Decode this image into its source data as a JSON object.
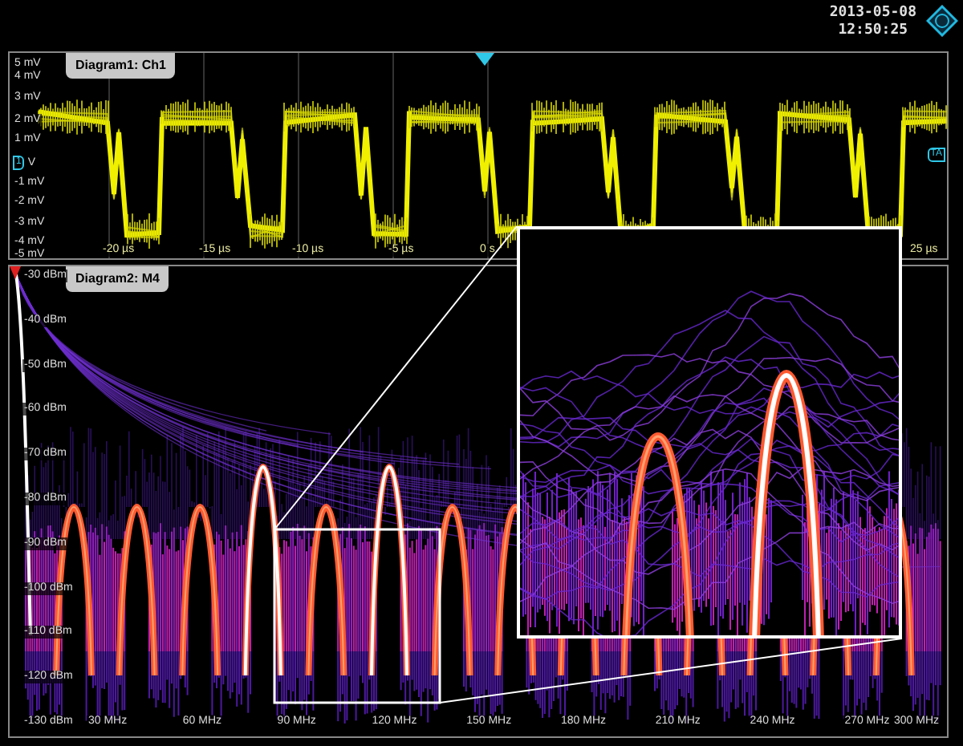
{
  "header": {
    "date": "2013-05-08",
    "time": "12:50:25"
  },
  "diagram1": {
    "title": "Diagram1: Ch1",
    "zero_marker": "1",
    "trigger_marker": "TA",
    "y_axis_labels": [
      "5 mV",
      "4 mV",
      "3 mV",
      "2 mV",
      "1 mV",
      "V",
      "-1 mV",
      "-2 mV",
      "-3 mV",
      "-4 mV",
      "-5 mV"
    ],
    "x_axis_labels": [
      "-20 µs",
      "-15 µs",
      "-10 µs",
      "-5 µs",
      "0 s",
      "25 µs"
    ]
  },
  "diagram2": {
    "title": "Diagram2: M4",
    "y_axis_labels": [
      "-30 dBm",
      "-40 dBm",
      "-50 dBm",
      "-60 dBm",
      "-70 dBm",
      "-80 dBm",
      "-90 dBm",
      "-100 dBm",
      "-110 dBm",
      "-120 dBm",
      "-130 dBm"
    ],
    "x_axis_labels": [
      "30 MHz",
      "60 MHz",
      "90 MHz",
      "120 MHz",
      "150 MHz",
      "180 MHz",
      "210 MHz",
      "240 MHz",
      "270 MHz",
      "300 MHz"
    ]
  }
}
